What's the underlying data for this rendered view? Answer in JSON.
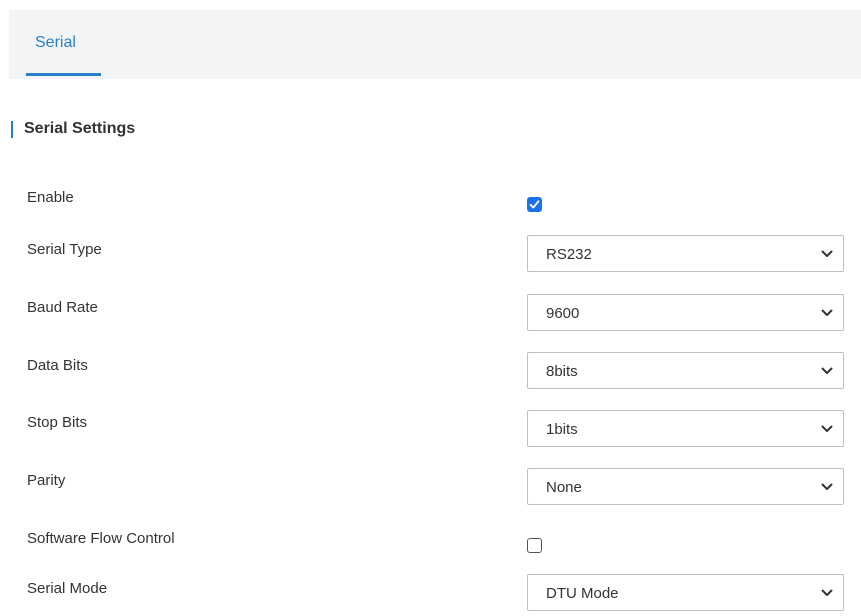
{
  "tabs": [
    {
      "label": "Serial",
      "active": true
    }
  ],
  "section": {
    "title": "Serial Settings"
  },
  "fields": {
    "enable": {
      "label": "Enable",
      "checked": true
    },
    "serial_type": {
      "label": "Serial Type",
      "value": "RS232"
    },
    "baud_rate": {
      "label": "Baud Rate",
      "value": "9600"
    },
    "data_bits": {
      "label": "Data Bits",
      "value": "8bits"
    },
    "stop_bits": {
      "label": "Stop Bits",
      "value": "1bits"
    },
    "parity": {
      "label": "Parity",
      "value": "None"
    },
    "software_flow_control": {
      "label": "Software Flow Control",
      "checked": false
    },
    "serial_mode": {
      "label": "Serial Mode",
      "value": "DTU Mode"
    }
  },
  "colors": {
    "accent": "#2b7fc7",
    "checkbox_checked": "#1a73e8",
    "tab_background": "#f3f4f5",
    "select_border": "#bfbfbf"
  },
  "icons": {
    "checkmark": "check-icon",
    "dropdown": "chevron-down-icon"
  }
}
